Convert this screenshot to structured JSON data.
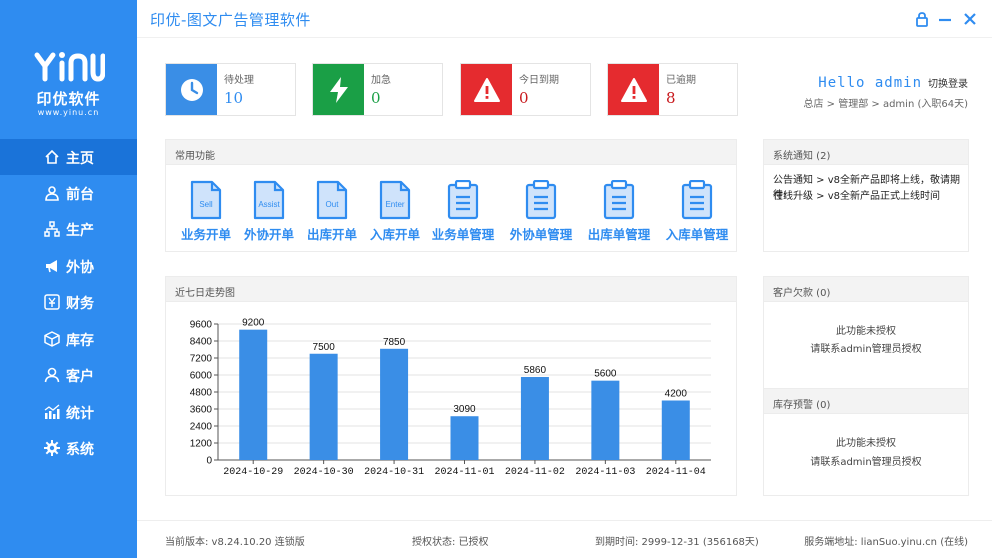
{
  "app": {
    "title": "印优-图文广告管理软件"
  },
  "logo": {
    "mark": "YINU",
    "name": "印优软件",
    "url": "www.yinu.cn"
  },
  "sidebar": {
    "items": [
      {
        "label": "主页",
        "icon": "home-icon"
      },
      {
        "label": "前台",
        "icon": "user-icon"
      },
      {
        "label": "生产",
        "icon": "hierarchy-icon"
      },
      {
        "label": "外协",
        "icon": "megaphone-icon"
      },
      {
        "label": "财务",
        "icon": "yen-icon"
      },
      {
        "label": "库存",
        "icon": "box-icon"
      },
      {
        "label": "客户",
        "icon": "person-icon"
      },
      {
        "label": "统计",
        "icon": "chart-icon"
      },
      {
        "label": "系统",
        "icon": "gear-icon"
      }
    ]
  },
  "stats": [
    {
      "label": "待处理",
      "value": "10",
      "color": "#3a8ee6",
      "value_color": "#2f8cf0",
      "icon": "clock-icon"
    },
    {
      "label": "加急",
      "value": "0",
      "color": "#1a9f46",
      "value_color": "#1a9f46",
      "icon": "bolt-icon"
    },
    {
      "label": "今日到期",
      "value": "0",
      "color": "#e52b2f",
      "value_color": "#c8181c",
      "icon": "warning-icon"
    },
    {
      "label": "已逾期",
      "value": "8",
      "color": "#e52b2f",
      "value_color": "#c8181c",
      "icon": "warning-icon"
    }
  ],
  "user": {
    "hello": "Hello admin",
    "switch_label": "切换登录",
    "breadcrumb": "总店 > 管理部 > admin (入职64天)"
  },
  "functions": {
    "title": "常用功能",
    "items": [
      {
        "label": "业务开单",
        "tag": "Sell"
      },
      {
        "label": "外协开单",
        "tag": "Assist"
      },
      {
        "label": "出库开单",
        "tag": "Out"
      },
      {
        "label": "入库开单",
        "tag": "Enter"
      },
      {
        "label": "业务单管理",
        "tag": ""
      },
      {
        "label": "外协单管理",
        "tag": ""
      },
      {
        "label": "出库单管理",
        "tag": ""
      },
      {
        "label": "入库单管理",
        "tag": ""
      }
    ]
  },
  "notice": {
    "title": "系统通知 (2)",
    "lines": [
      "公告通知 > v8全新产品即将上线，敬请期待!",
      "在线升级 > v8全新产品正式上线时间"
    ]
  },
  "debt": {
    "title": "客户欠款 (0)",
    "line1": "此功能未授权",
    "line2": "请联系admin管理员授权"
  },
  "stock": {
    "title": "库存预警 (0)",
    "line1": "此功能未授权",
    "line2": "请联系admin管理员授权"
  },
  "trend": {
    "title": "近七日走势图"
  },
  "chart_data": {
    "type": "bar",
    "categories": [
      "2024-10-29",
      "2024-10-30",
      "2024-10-31",
      "2024-11-01",
      "2024-11-02",
      "2024-11-03",
      "2024-11-04"
    ],
    "values": [
      9200,
      7500,
      7850,
      3090,
      5860,
      5600,
      4200
    ],
    "yticks": [
      0,
      1200,
      2400,
      3600,
      4800,
      6000,
      7200,
      8400,
      9600
    ],
    "ylim": [
      0,
      9600
    ],
    "grid": true,
    "bar_color": "#3a8ee6",
    "title": "",
    "xlabel": "",
    "ylabel": ""
  },
  "footer": {
    "version": "当前版本: v8.24.10.20  连锁版",
    "license": "授权状态: 已授权",
    "expire": "到期时间: 2999-12-31 (356168天)",
    "server": "服务端地址: lianSuo.yinu.cn (在线)"
  }
}
